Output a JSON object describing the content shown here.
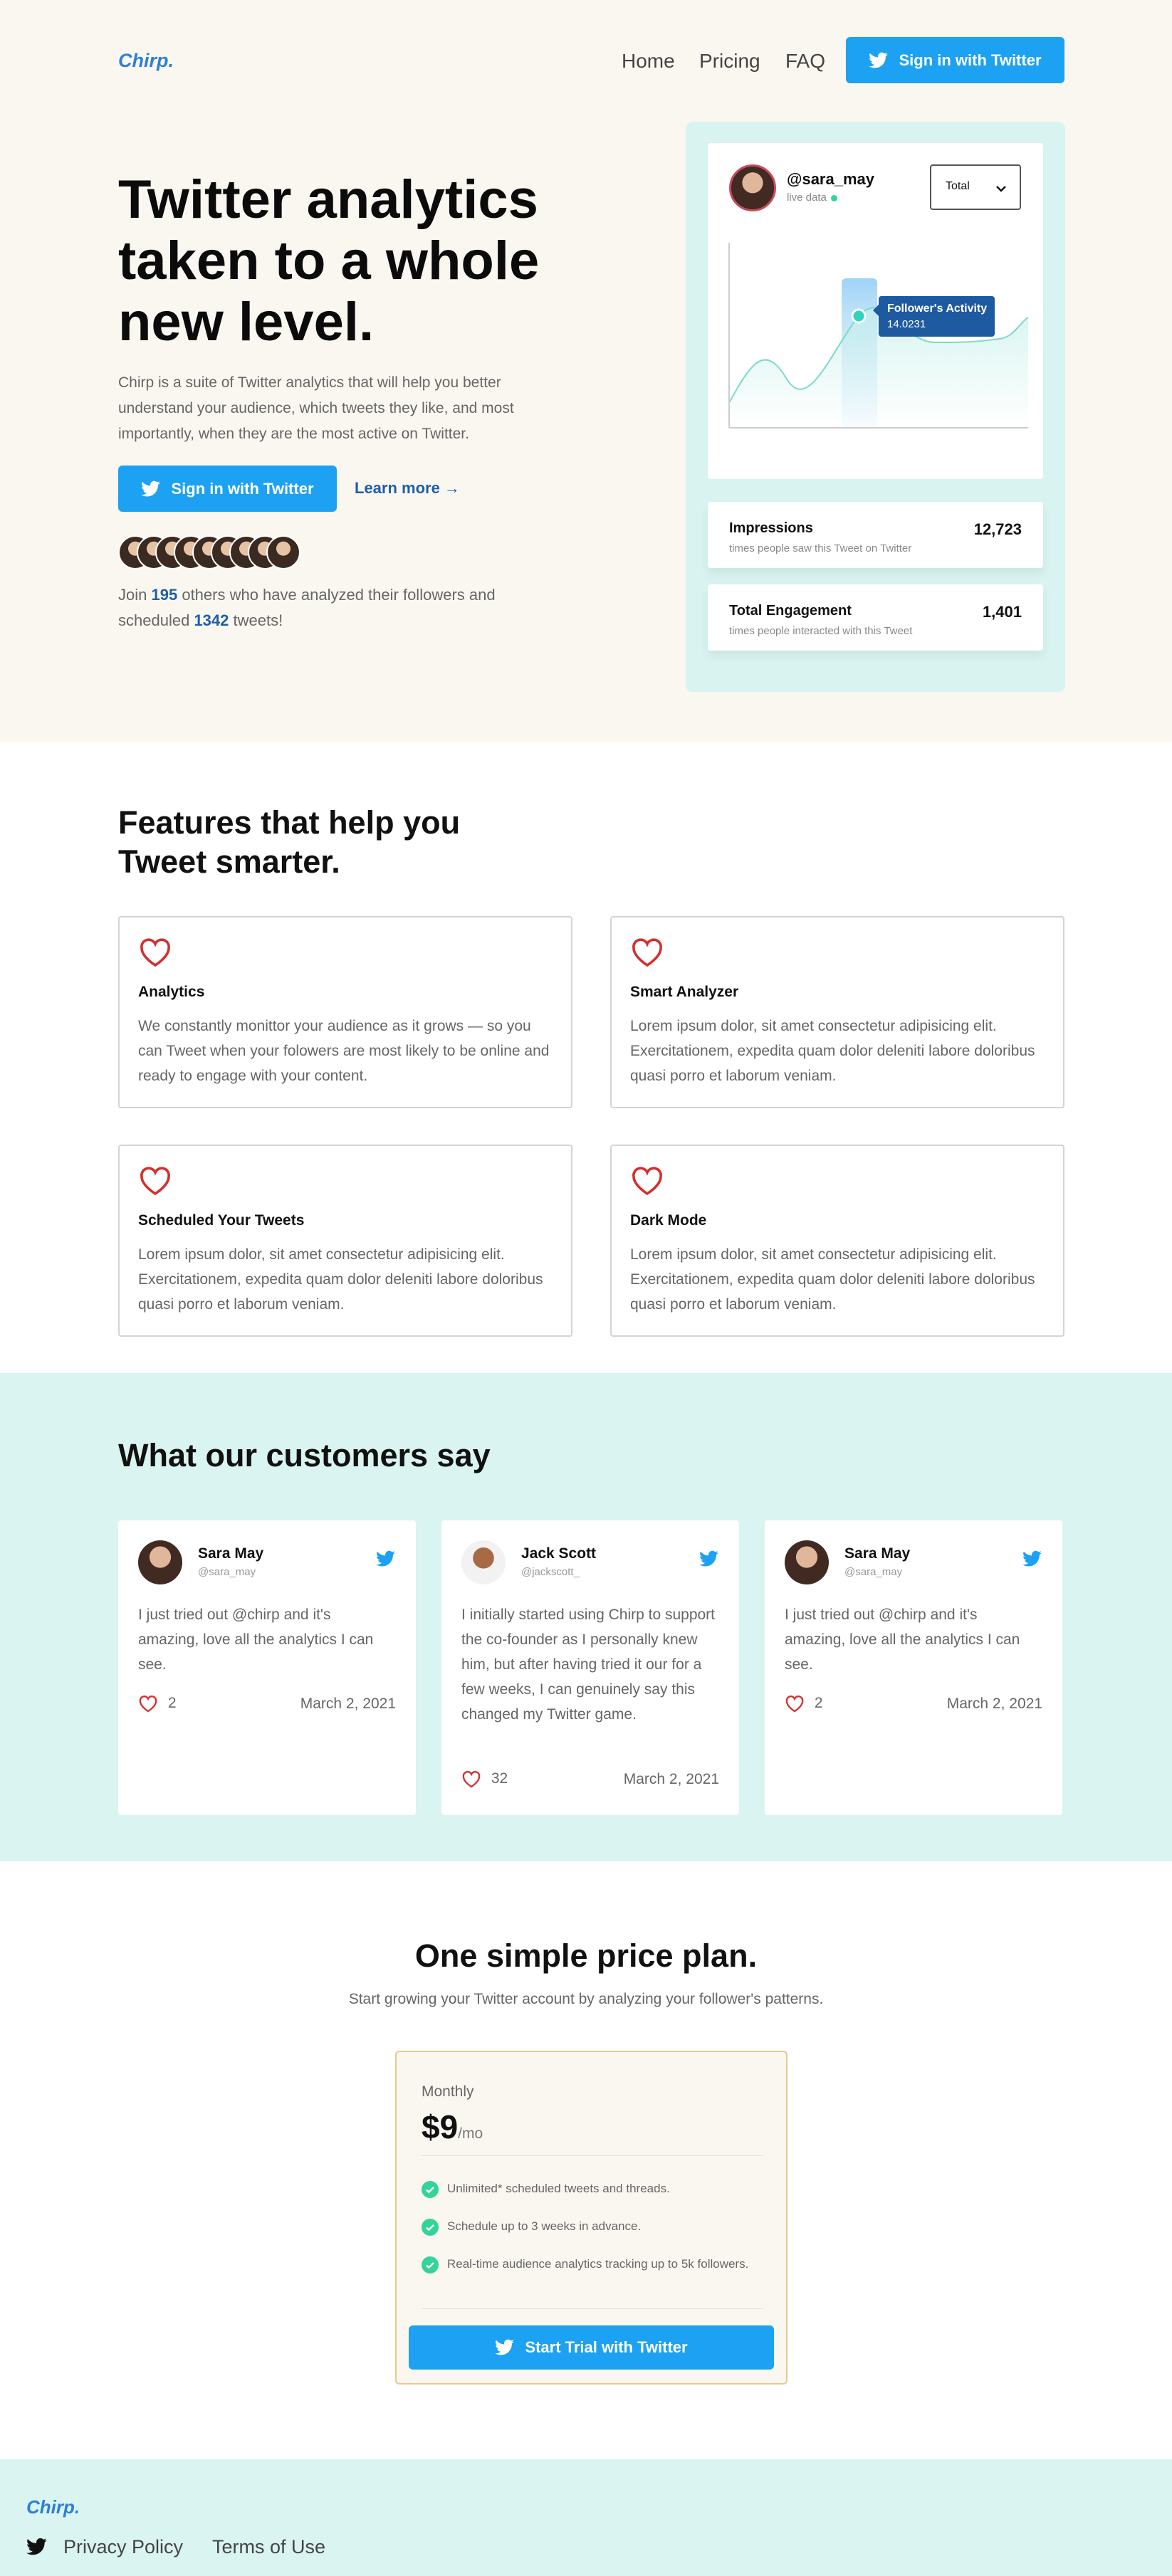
{
  "brand": {
    "logo": "Chirp."
  },
  "nav": {
    "home": "Home",
    "pricing": "Pricing",
    "faq": "FAQ",
    "signin": "Sign in with Twitter"
  },
  "hero": {
    "title": "Twitter analytics taken to a whole new level.",
    "lead": "Chirp is a suite of Twitter analytics that will help you better understand your audience, which tweets they like, and most importantly, when they are the most active on Twitter.",
    "cta": "Sign in with Twitter",
    "learn_more": "Learn more →",
    "join_prefix": "Join",
    "join_count": "195",
    "join_middle": "others who have analyzed their followers and scheduled",
    "tweet_count": "1342",
    "join_suffix": "tweets!"
  },
  "dashboard": {
    "handle": "@sara_may",
    "status": "live data",
    "select_value": "Total",
    "tooltip_label": "Follower's Activity",
    "tooltip_value": "14.0231",
    "stats": [
      {
        "label": "Impressions",
        "desc": "times people saw this Tweet on Twitter",
        "value": "12,723"
      },
      {
        "label": "Total Engagement",
        "desc": "times people interacted with this Tweet",
        "value": "1,401"
      }
    ]
  },
  "features": {
    "title": "Features that help you Tweet smarter.",
    "items": [
      {
        "title": "Analytics",
        "desc": "We constantly monittor your audience as it grows — so you can Tweet when your folowers are most likely to be online and ready to engage with your content."
      },
      {
        "title": "Smart Analyzer",
        "desc": "Lorem ipsum dolor, sit amet consectetur adipisicing elit. Exercitationem, expedita quam dolor deleniti labore doloribus quasi porro et laborum veniam."
      },
      {
        "title": "Scheduled Your Tweets",
        "desc": "Lorem ipsum dolor, sit amet consectetur adipisicing elit. Exercitationem, expedita quam dolor deleniti labore doloribus quasi porro et laborum veniam."
      },
      {
        "title": "Dark Mode",
        "desc": "Lorem ipsum dolor, sit amet consectetur adipisicing elit. Exercitationem, expedita quam dolor deleniti labore doloribus quasi porro et laborum veniam."
      }
    ]
  },
  "testimonials": {
    "title": "What our customers say",
    "items": [
      {
        "name": "Sara May",
        "handle": "@sara_may",
        "text": "I just tried out @chirp and it's amazing, love all the analytics I can see.",
        "likes": "2",
        "date": "March 2, 2021"
      },
      {
        "name": "Jack Scott",
        "handle": "@jackscott_",
        "text": "I initially started using Chirp to support the co-founder as I personally knew him, but after having tried it our for a few weeks, I can genuinely say this changed my Twitter game.",
        "likes": "32",
        "date": "March 2, 2021"
      },
      {
        "name": "Sara May",
        "handle": "@sara_may",
        "text": "I just tried out @chirp and it's amazing, love all the analytics I can see.",
        "likes": "2",
        "date": "March 2, 2021"
      }
    ]
  },
  "pricing": {
    "title": "One simple price plan.",
    "subtitle": "Start growing your Twitter account by analyzing your follower's patterns.",
    "period": "Monthly",
    "price": "$9",
    "per": "/mo",
    "features": [
      "Unlimited* scheduled tweets and threads.",
      "Schedule up to 3 weeks in advance.",
      "Real-time audience analytics tracking up to 5k followers."
    ],
    "cta": "Start Trial with Twitter"
  },
  "footer": {
    "privacy": "Privacy Policy",
    "terms": "Terms of Use"
  },
  "colors": {
    "accent": "#1da1f2",
    "brand": "#2f7fd6",
    "heart": "#d32f2f",
    "mint": "#d9f4f1",
    "cream": "#faf7f1"
  },
  "icons": {
    "twitter": "twitter-bird-icon",
    "heart": "heart-icon",
    "check": "check-icon",
    "chevron": "chevron-down-icon"
  }
}
